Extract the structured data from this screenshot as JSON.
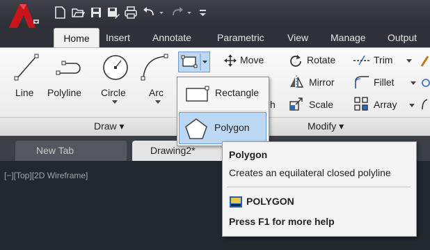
{
  "quick_access": {
    "icons": [
      "new-icon",
      "open-icon",
      "save-icon",
      "save-as-icon",
      "print-icon",
      "undo-icon",
      "redo-icon"
    ]
  },
  "tabs": [
    {
      "label": "Home",
      "active": true
    },
    {
      "label": "Insert"
    },
    {
      "label": "Annotate"
    },
    {
      "label": "Parametric"
    },
    {
      "label": "View"
    },
    {
      "label": "Manage"
    },
    {
      "label": "Output"
    }
  ],
  "draw_panel": {
    "tools": [
      "Line",
      "Polyline",
      "Circle",
      "Arc"
    ],
    "title": "Draw ▾"
  },
  "modify_panel": {
    "move": "Move",
    "rotate": "Rotate",
    "trim": "Trim",
    "mirror": "Mirror",
    "fillet": "Fillet",
    "stretch_fragment": "h",
    "scale": "Scale",
    "array": "Array",
    "title": "Modify ▾"
  },
  "shape_dropdown": {
    "rectangle": "Rectangle",
    "polygon": "Polygon"
  },
  "doc_tabs": {
    "new_tab": "New Tab",
    "drawing": "Drawing2*"
  },
  "viewport_label": "[−][Top][2D Wireframe]",
  "tooltip": {
    "title": "Polygon",
    "description": "Creates an equilateral closed polyline",
    "command": "POLYGON",
    "help": "Press F1 for more help"
  },
  "colors": {
    "brand_red": "#c8151b",
    "highlight_blue": "#bcd8f2",
    "canvas": "#212830"
  }
}
